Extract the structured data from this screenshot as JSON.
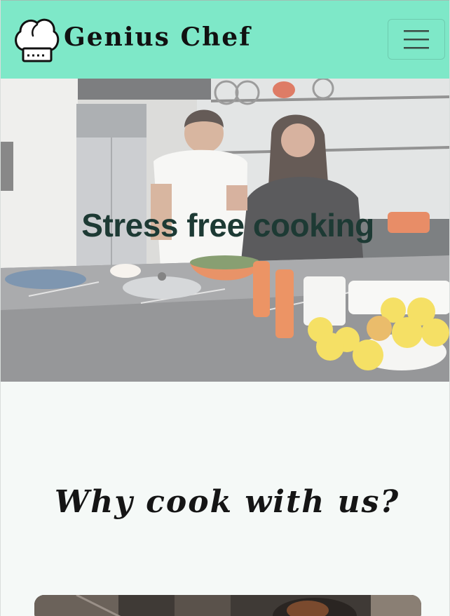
{
  "navbar": {
    "brand_name": "Genius Chef",
    "logo_icon": "chef-hat-icon",
    "menu_icon": "hamburger-menu-icon",
    "background": "#7ee8c8"
  },
  "hero": {
    "title": "Stress free cooking",
    "title_color": "#1d3a34"
  },
  "why": {
    "title": "Why cook with us?"
  },
  "colors": {
    "page_background": "#f5f9f7",
    "navbar_accent": "#7ee8c8"
  }
}
